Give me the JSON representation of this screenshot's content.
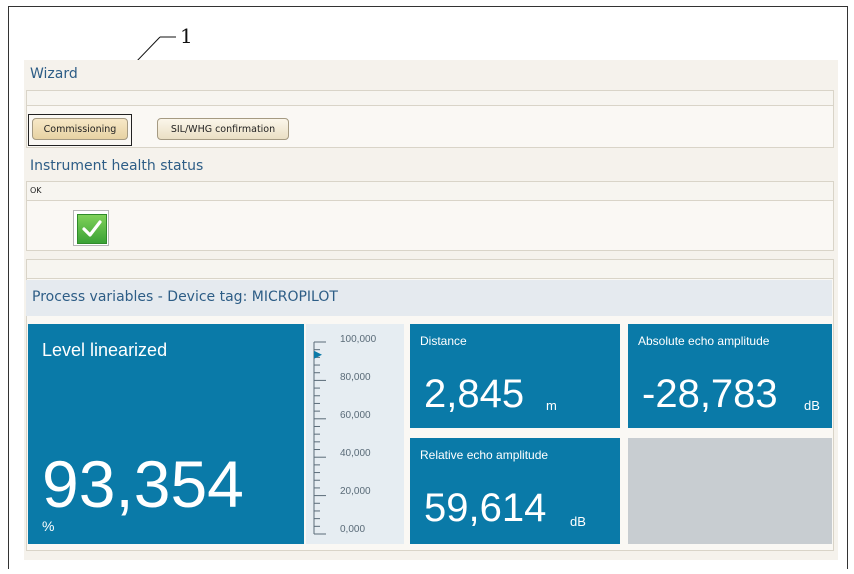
{
  "callout": {
    "number": "1"
  },
  "wizard": {
    "title": "Wizard",
    "buttons": [
      "Commissioning",
      "SIL/WHG confirmation"
    ]
  },
  "health": {
    "title": "Instrument health status",
    "status_text": "OK",
    "status_icon": "check-icon"
  },
  "process": {
    "header": "Process variables - Device tag: MICROPILOT",
    "level": {
      "label": "Level linearized",
      "value": "93,354",
      "unit": "%",
      "fill_percent": 93.354
    },
    "gauge_ticks": [
      "100,000",
      "80,000",
      "60,000",
      "40,000",
      "20,000",
      "0,000"
    ],
    "distance": {
      "label": "Distance",
      "value": "2,845",
      "unit": "m"
    },
    "absolute_echo": {
      "label": "Absolute echo amplitude",
      "value": "-28,783",
      "unit": "dB"
    },
    "relative_echo": {
      "label": "Relative echo amplitude",
      "value": "59,614",
      "unit": "dB"
    }
  },
  "colors": {
    "tile_blue": "#0a7aa8",
    "title_blue": "#2d5d86",
    "empty_tile": "#c8cdd1"
  }
}
